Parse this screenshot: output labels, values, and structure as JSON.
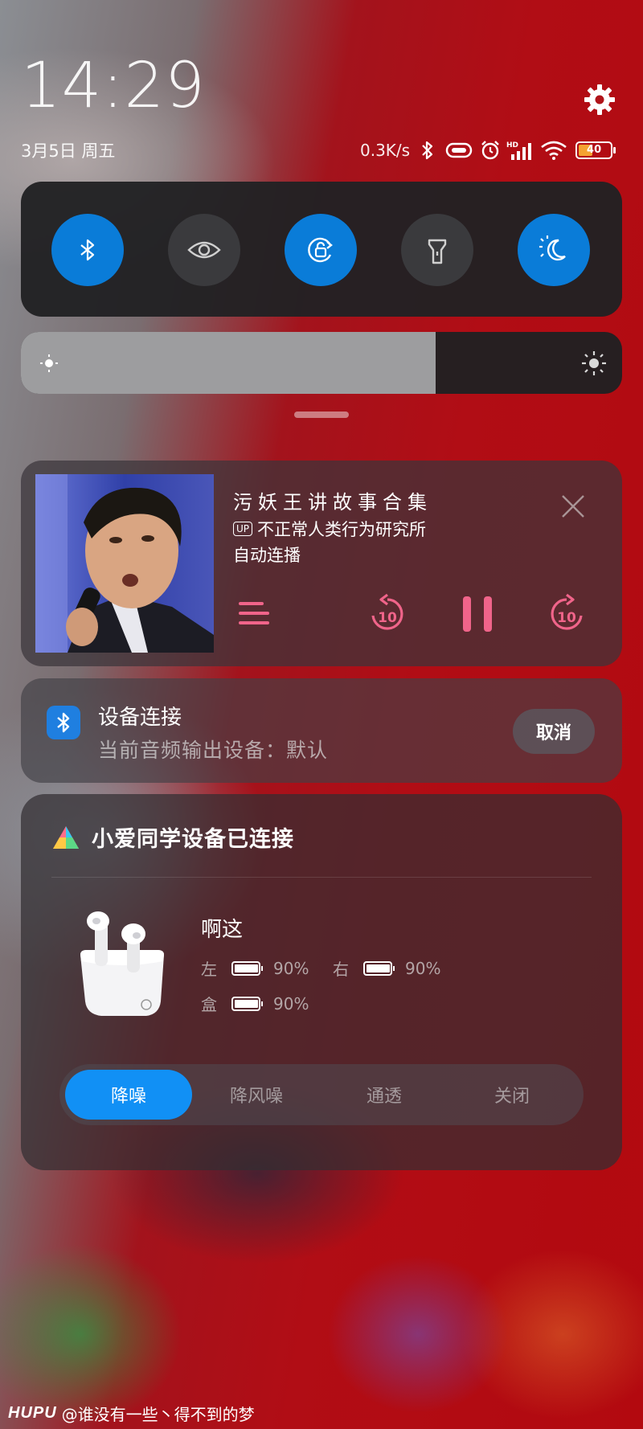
{
  "status": {
    "time": "14:29",
    "date": "3月5日 周五",
    "net_speed": "0.3K/s",
    "battery_level": "40",
    "battery_color": "#f4a231",
    "icons": [
      "bluetooth-icon",
      "vibrate-icon",
      "alarm-icon",
      "hd-signal-icon",
      "wifi-icon",
      "battery-icon"
    ]
  },
  "quick_toggles": [
    {
      "name": "bluetooth",
      "icon": "bluetooth-icon",
      "on": true
    },
    {
      "name": "eye-care",
      "icon": "eye-icon",
      "on": false
    },
    {
      "name": "rotation-lock",
      "icon": "rotation-lock-icon",
      "on": true
    },
    {
      "name": "flashlight",
      "icon": "flashlight-icon",
      "on": false
    },
    {
      "name": "dark-mode",
      "icon": "dark-mode-icon",
      "on": true
    }
  ],
  "brightness": {
    "level": 0.69
  },
  "media": {
    "title": "污妖王讲故事合集",
    "up_badge": "UP",
    "uploader": "不正常人类行为研究所",
    "subtitle": "自动连播",
    "accent_color": "#f0648a"
  },
  "device": {
    "title": "设备连接",
    "subtitle": "当前音频输出设备：默认",
    "cancel_label": "取消"
  },
  "xiaoai": {
    "title": "小爱同学设备已连接",
    "device_name": "啊这",
    "left_label": "左",
    "left_value": "90%",
    "right_label": "右",
    "right_value": "90%",
    "case_label": "盒",
    "case_value": "90%",
    "modes": [
      "降噪",
      "降风噪",
      "通透",
      "关闭"
    ],
    "active_mode": 0,
    "active_color": "#1190f5"
  },
  "watermark": {
    "brand": "HUPU",
    "user": "@谁没有一些丶得不到的梦"
  }
}
